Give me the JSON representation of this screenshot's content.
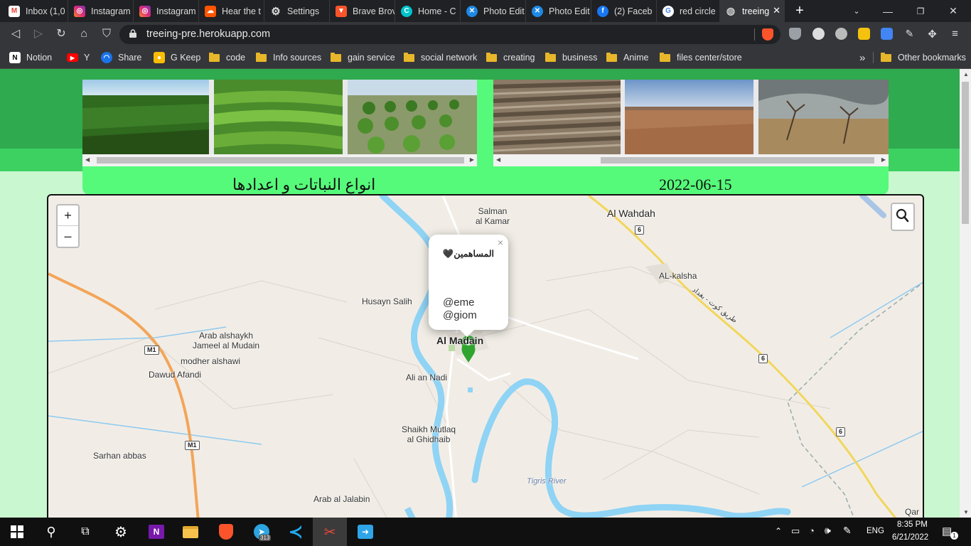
{
  "browser": {
    "tabs": [
      {
        "title": "Inbox (1,0",
        "icon": "gmail-icon",
        "color": "#ea4335"
      },
      {
        "title": "Instagram",
        "icon": "instagram-icon",
        "color": "#d6249f"
      },
      {
        "title": "Instagram",
        "icon": "instagram-icon",
        "color": "#d6249f"
      },
      {
        "title": "Hear the t",
        "icon": "soundcloud-icon",
        "color": "#ff5500"
      },
      {
        "title": "Settings",
        "icon": "gear-icon",
        "color": "#9aa0a6"
      },
      {
        "title": "Brave Brov",
        "icon": "brave-icon",
        "color": "#fb542b"
      },
      {
        "title": "Home - C",
        "icon": "canva-icon",
        "color": "#00c4cc"
      },
      {
        "title": "Photo Edit",
        "icon": "photo-editor-icon",
        "color": "#1e88e5"
      },
      {
        "title": "Photo Edit",
        "icon": "photo-editor-icon",
        "color": "#1e88e5"
      },
      {
        "title": "(2) Faceb",
        "icon": "facebook-icon",
        "color": "#1877f2"
      },
      {
        "title": "red circle",
        "icon": "google-icon",
        "color": "#4285f4"
      },
      {
        "title": "treeing",
        "icon": "globe-icon",
        "color": "#9aa0a6",
        "active": true
      }
    ],
    "url": "treeing-pre.herokuapp.com"
  },
  "bookmarks": [
    {
      "label": "Notion",
      "type": "notion"
    },
    {
      "label": "Y",
      "type": "youtube"
    },
    {
      "label": "Share",
      "type": "share"
    },
    {
      "label": "G Keep",
      "type": "keep"
    },
    {
      "label": "code",
      "type": "folder"
    },
    {
      "label": "Info sources",
      "type": "folder"
    },
    {
      "label": "gain service",
      "type": "folder"
    },
    {
      "label": "social network",
      "type": "folder"
    },
    {
      "label": "creating",
      "type": "folder"
    },
    {
      "label": "business",
      "type": "folder"
    },
    {
      "label": "Anime",
      "type": "folder"
    },
    {
      "label": "files center/store",
      "type": "folder"
    }
  ],
  "bookmarks_more": "»",
  "other_bookmarks": "Other bookmarks",
  "page": {
    "caption_left": "انواع النباتات و اعدادها",
    "caption_right": "2022-06-15",
    "colors": {
      "band_top": "#2faa4e",
      "band_mid": "#3cd161",
      "card": "#56fa7a",
      "page_bg": "#c9f7cf"
    }
  },
  "map": {
    "zoom_in": "+",
    "zoom_out": "–",
    "popup": {
      "close": "×",
      "title": "المساهمين🖤",
      "lines": [
        "@eme",
        "@giom"
      ]
    },
    "labels": {
      "salman": "Salman\nal Kamar",
      "wahdah": "Al Wahdah",
      "kalsha": "AL-kalsha",
      "husayn": "Husayn Salih",
      "arab_shaykh": "Arab  alshaykh\nJameel al Mudain",
      "modher": "modher alshawi",
      "dawud": "Dawud Afandi",
      "almudain": "Al Madain",
      "alinadi": "Ali an Nadi",
      "shaikh": "Shaikh Mutlaq\nal Ghidhaib",
      "sarhan": "Sarhan abbas",
      "jalabin": "Arab al Jalabin",
      "tigris": "Tigris River",
      "road_ar": "طريق كوت - بغداد",
      "qar": "Qar"
    },
    "shields": {
      "m1": "M1",
      "r6": "6"
    }
  },
  "taskbar": {
    "telegram_badge": "313",
    "lang": "ENG",
    "time": "8:35 PM",
    "date": "6/21/2022",
    "notifications": "1"
  }
}
